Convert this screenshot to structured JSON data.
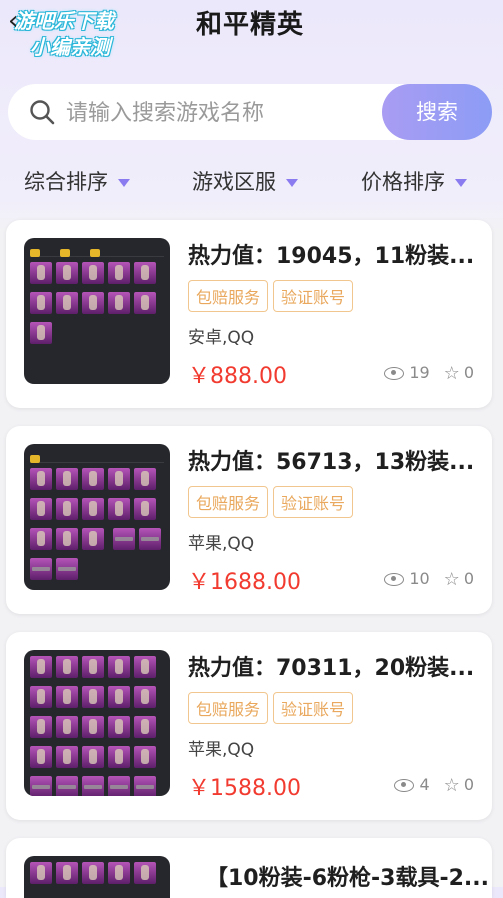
{
  "header": {
    "title": "和平精英",
    "watermark_line1": "游吧乐下载",
    "watermark_line2": "小编亲测"
  },
  "search": {
    "placeholder": "请输入搜索游戏名称",
    "button_label": "搜索"
  },
  "filters": [
    {
      "label": "综合排序"
    },
    {
      "label": "游戏区服"
    },
    {
      "label": "价格排序"
    }
  ],
  "listings": [
    {
      "title": "热力值：19045，11粉装...",
      "tags": [
        "包赔服务",
        "验证账号"
      ],
      "platform": "安卓,QQ",
      "price": "￥888.00",
      "views": "19",
      "favorites": "0"
    },
    {
      "title": "热力值：56713，13粉装...",
      "tags": [
        "包赔服务",
        "验证账号"
      ],
      "platform": "苹果,QQ",
      "price": "￥1688.00",
      "views": "10",
      "favorites": "0"
    },
    {
      "title": "热力值：70311，20粉装...",
      "tags": [
        "包赔服务",
        "验证账号"
      ],
      "platform": "苹果,QQ",
      "price": "￥1588.00",
      "views": "4",
      "favorites": "0"
    },
    {
      "title": "【10粉装-6粉枪-3载具-2..."
    }
  ],
  "colors": {
    "accent": "#8c9cf5",
    "price": "#f23b30",
    "tag": "#e9a85d"
  },
  "icons": [
    "back-arrow-icon",
    "search-icon",
    "caret-down-icon",
    "eye-icon",
    "star-icon"
  ]
}
